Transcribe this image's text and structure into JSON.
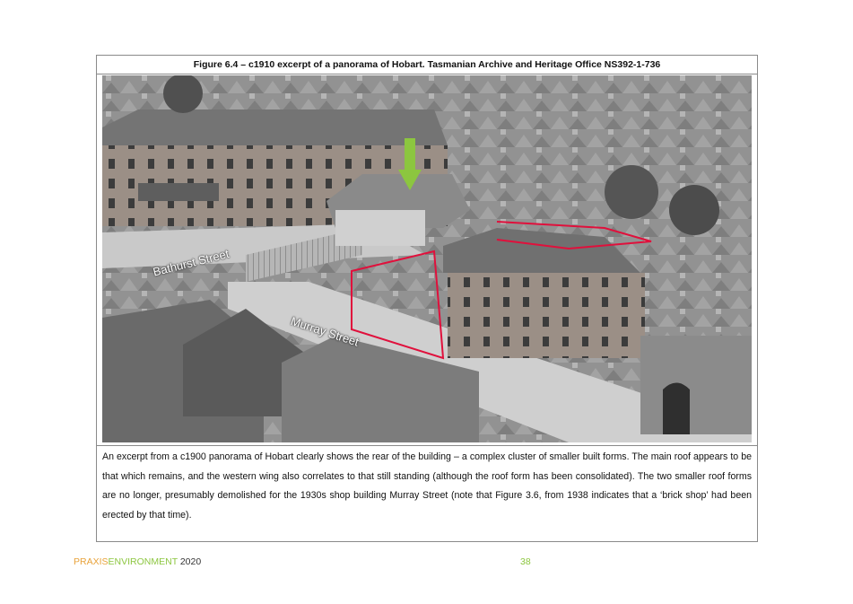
{
  "figure": {
    "caption": "Figure 6.4 – c1910 excerpt of a panorama of Hobart.  Tasmanian Archive and Heritage Office NS392-1-736",
    "photo_labels": {
      "street_1": "Bathurst Street",
      "street_2": "Murray Street"
    },
    "annotation_colors": {
      "arrow": "#8cc63f",
      "outline": "#e0103c"
    },
    "description": "An excerpt from a c1900 panorama of Hobart clearly shows the rear of the building – a complex cluster of smaller built forms.  The main roof appears to be that which remains, and the western wing also correlates to that still standing (although the roof form has been consolidated).  The two smaller roof forms are no longer, presumably demolished for the 1930s shop building Murray Street (note that Figure 3.6, from 1938 indicates that a ‘brick shop’ had been erected by that time)."
  },
  "footer": {
    "brand_part1": "PRAXIS",
    "brand_part2": "ENVIRONMENT",
    "year": " 2020",
    "page_number": "38"
  }
}
